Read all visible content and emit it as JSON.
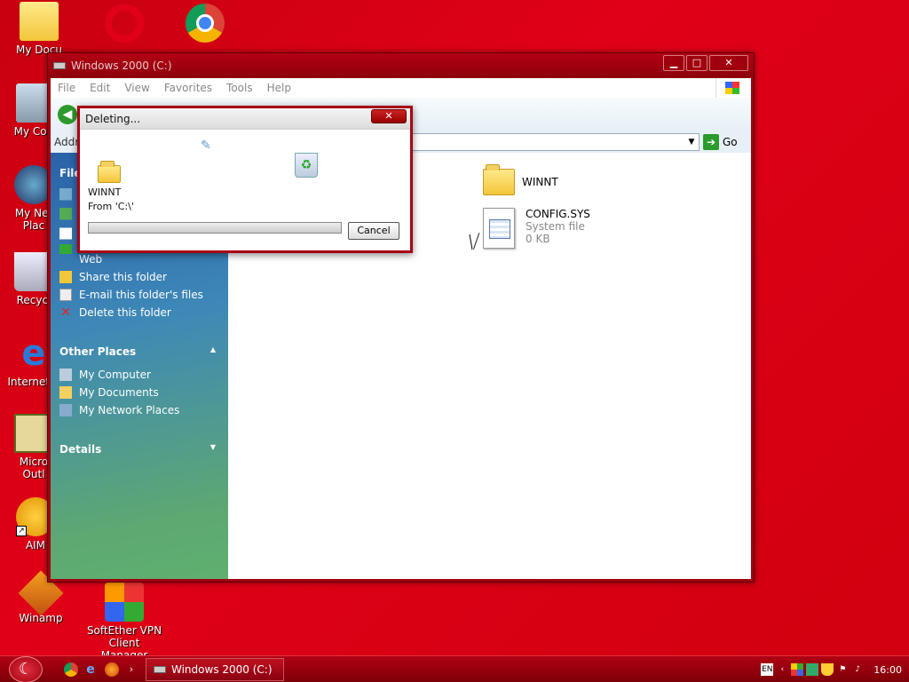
{
  "desktop": {
    "icons": [
      {
        "label": "My Docu",
        "icon": "my-documents-icon"
      },
      {
        "label": "My Com",
        "icon": "my-computer-icon"
      },
      {
        "label": "My Net Plac",
        "icon": "network-places-icon"
      },
      {
        "label": "Recycl",
        "icon": "recycle-bin-icon"
      },
      {
        "label": "Internet E",
        "icon": "internet-explorer-icon"
      },
      {
        "label": "Micro Outl",
        "icon": "outlook-icon"
      },
      {
        "label": "AIM",
        "icon": "aim-icon"
      },
      {
        "label": "Winamp",
        "icon": "winamp-icon"
      },
      {
        "label": "SoftEther VPN Client Manager",
        "icon": "softether-icon"
      }
    ]
  },
  "window": {
    "title": "Windows 2000 (C:)",
    "menu": [
      "File",
      "Edit",
      "View",
      "Favorites",
      "Tools",
      "Help"
    ],
    "address_label": "Addr",
    "go_label": "Go",
    "sidebar": {
      "file_tasks_header": "File",
      "tasks": [
        "Web",
        "Share this folder",
        "E-mail this folder's files",
        "Delete this folder"
      ],
      "other_places_header": "Other Places",
      "places": [
        "My Computer",
        "My Documents",
        "My Network Places"
      ],
      "details_header": "Details"
    },
    "files": [
      {
        "name": "WINNT"
      },
      {
        "name": "CONFIG.SYS",
        "type": "System file",
        "size": "0 KB"
      }
    ]
  },
  "dialog": {
    "title": "Deleting...",
    "close": "✕",
    "item_name": "WINNT",
    "from_text": "From 'C:\\'",
    "cancel_label": "Cancel"
  },
  "taskbar": {
    "task_label": "Windows 2000 (C:)",
    "language": "EN",
    "clock": "16:00"
  }
}
